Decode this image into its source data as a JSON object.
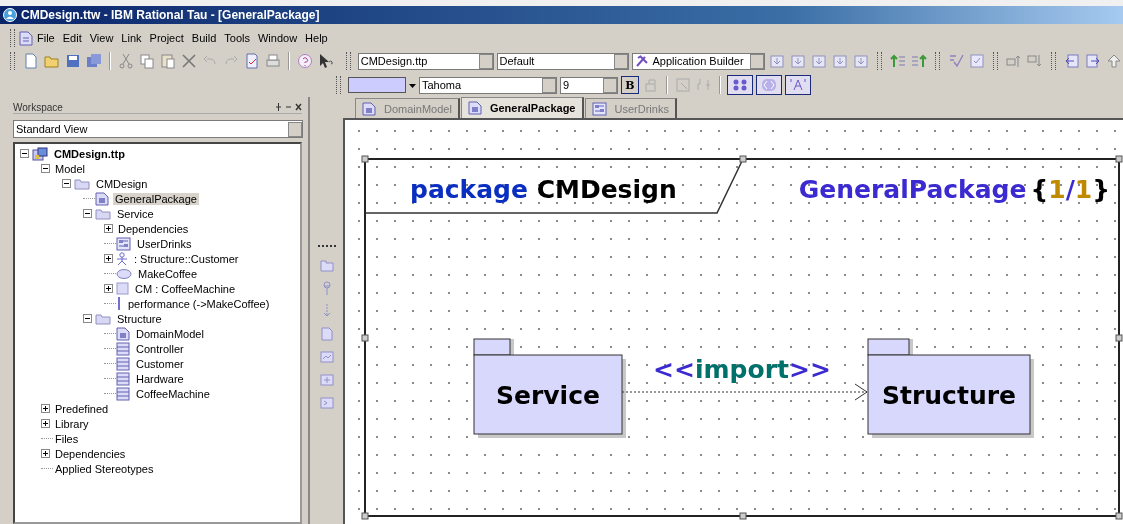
{
  "window": {
    "title": "CMDesign.ttw - IBM Rational Tau - [GeneralPackage]"
  },
  "menu": [
    "File",
    "Edit",
    "View",
    "Link",
    "Project",
    "Build",
    "Tools",
    "Window",
    "Help"
  ],
  "toolbar": {
    "project": "CMDesign.ttp",
    "configuration": "Default",
    "builder": "Application Builder"
  },
  "format_bar": {
    "font": "Tahoma",
    "size": "9",
    "bold_label": "B"
  },
  "workspace": {
    "title": "Workspace",
    "view": "Standard View",
    "tree": [
      {
        "label": "CMDesign.ttp",
        "kind": "project",
        "expanded": true,
        "selected": false,
        "children": [
          {
            "label": "Model",
            "expanded": true,
            "selected": false,
            "children": [
              {
                "label": "CMDesign",
                "kind": "folder",
                "expanded": true,
                "selected": false,
                "children": [
                  {
                    "label": "GeneralPackage",
                    "kind": "diagram",
                    "selected": true
                  },
                  {
                    "label": "Service",
                    "kind": "folder",
                    "expanded": true,
                    "selected": false,
                    "children": [
                      {
                        "label": "Dependencies",
                        "expanded": false,
                        "selected": false
                      },
                      {
                        "label": "UserDrinks",
                        "kind": "interaction",
                        "selected": false
                      },
                      {
                        "label": " : Structure::Customer",
                        "kind": "actor",
                        "expanded": false,
                        "selected": false
                      },
                      {
                        "label": "MakeCoffee",
                        "kind": "usecase",
                        "selected": false
                      },
                      {
                        "label": "CM : CoffeeMachine",
                        "kind": "part",
                        "expanded": false,
                        "selected": false
                      },
                      {
                        "label": "performance (->MakeCoffee)",
                        "kind": "lifeline",
                        "selected": false
                      }
                    ]
                  },
                  {
                    "label": "Structure",
                    "kind": "folder",
                    "expanded": true,
                    "selected": false,
                    "children": [
                      {
                        "label": "DomainModel",
                        "kind": "diagram",
                        "selected": false
                      },
                      {
                        "label": "Controller",
                        "kind": "class",
                        "selected": false
                      },
                      {
                        "label": "Customer",
                        "kind": "class",
                        "selected": false
                      },
                      {
                        "label": "Hardware",
                        "kind": "class",
                        "selected": false
                      },
                      {
                        "label": "CoffeeMachine",
                        "kind": "class",
                        "selected": false
                      }
                    ]
                  }
                ]
              }
            ]
          },
          {
            "label": "Predefined",
            "expanded": false,
            "selected": false
          },
          {
            "label": "Library",
            "expanded": false,
            "selected": false
          },
          {
            "label": "Files",
            "selected": false
          },
          {
            "label": "Dependencies",
            "expanded": false,
            "selected": false
          },
          {
            "label": "Applied Stereotypes",
            "selected": false
          }
        ]
      }
    ]
  },
  "tabs": [
    {
      "label": "DomainModel",
      "kind": "diagram",
      "selected": false
    },
    {
      "label": "GeneralPackage",
      "kind": "diagram",
      "selected": true
    },
    {
      "label": "UserDrinks",
      "kind": "interaction",
      "selected": false
    }
  ],
  "diagram": {
    "keyword": "package",
    "name": "CMDesign",
    "diagram_name": "GeneralPackage",
    "page": {
      "open": "{",
      "current": "1",
      "separator": "/",
      "total": "1",
      "close": "}"
    },
    "packages": [
      {
        "name": "Service"
      },
      {
        "name": "Structure"
      }
    ],
    "dependency": {
      "open": "<<",
      "keyword": "import",
      "close": ">>"
    }
  }
}
